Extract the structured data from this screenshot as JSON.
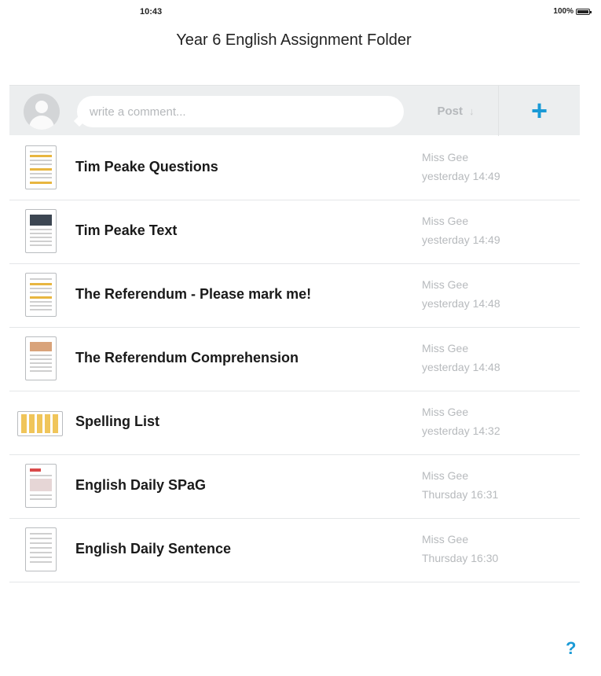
{
  "status_bar": {
    "time": "10:43",
    "battery_pct": "100%"
  },
  "page": {
    "title": "Year 6 English Assignment Folder"
  },
  "comment_bar": {
    "placeholder": "write a comment...",
    "post_label": "Post",
    "post_icon": "arrow-down-icon",
    "add_label": "+",
    "accent_color": "#1a9ad6"
  },
  "files": [
    {
      "name": "Tim Peake Questions",
      "author": "Miss Gee",
      "time": "yesterday 14:49",
      "thumb": "worksheet-portrait"
    },
    {
      "name": "Tim Peake Text",
      "author": "Miss Gee",
      "time": "yesterday 14:49",
      "thumb": "photo-text-portrait"
    },
    {
      "name": "The Referendum - Please mark me!",
      "author": "Miss Gee",
      "time": "yesterday 14:48",
      "thumb": "worksheet-portrait"
    },
    {
      "name": "The Referendum Comprehension",
      "author": "Miss Gee",
      "time": "yesterday 14:48",
      "thumb": "image-text-portrait"
    },
    {
      "name": "Spelling List",
      "author": "Miss Gee",
      "time": "yesterday 14:32",
      "thumb": "columns-landscape"
    },
    {
      "name": "English Daily SPaG",
      "author": "Miss Gee",
      "time": "Thursday 16:31",
      "thumb": "red-header-portrait"
    },
    {
      "name": "English Daily Sentence",
      "author": "Miss Gee",
      "time": "Thursday 16:30",
      "thumb": "lined-portrait"
    }
  ],
  "help": {
    "label": "?"
  }
}
